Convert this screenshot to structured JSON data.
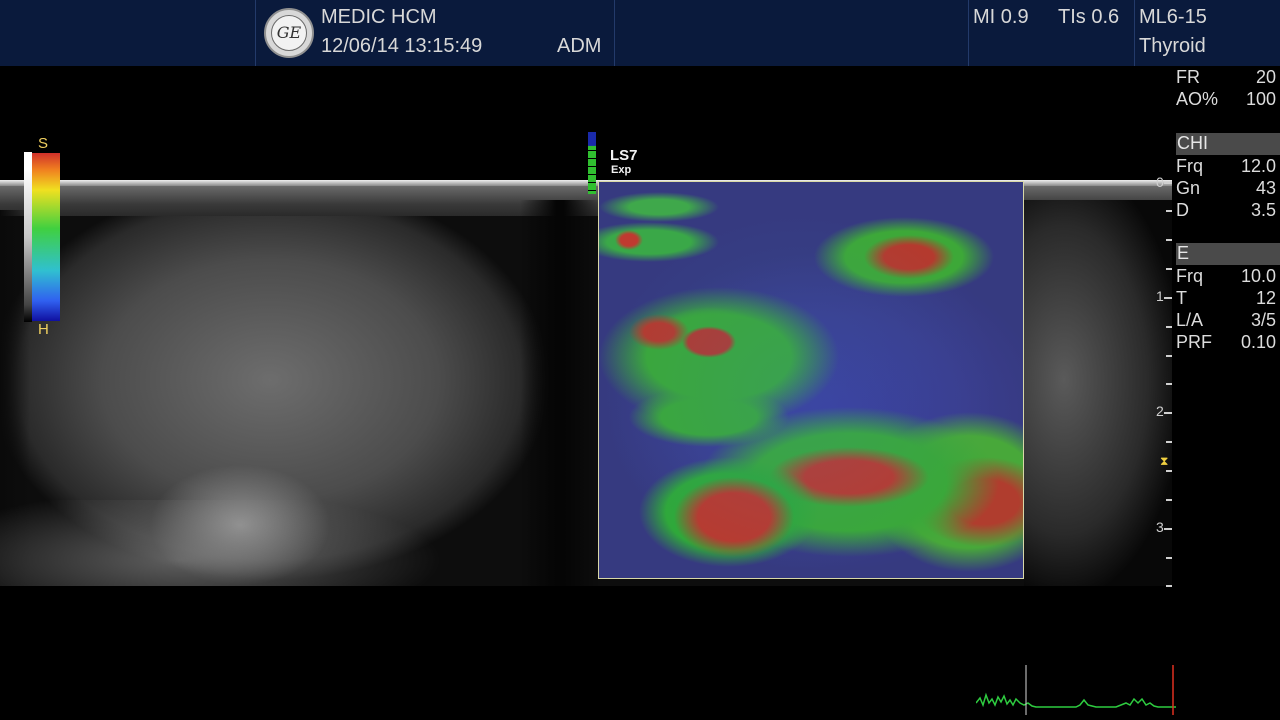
{
  "header": {
    "logo_text": "GE",
    "site": "MEDIC HCM",
    "datetime": "12/06/14 13:15:49",
    "operator": "ADM",
    "mi": "MI 0.9",
    "tis": "TIs 0.6",
    "probe": "ML6-15",
    "preset": "Thyroid"
  },
  "params": {
    "general": [
      {
        "key": "FR",
        "value": "20"
      },
      {
        "key": "AO%",
        "value": "100"
      }
    ],
    "chi_title": "CHI",
    "chi": [
      {
        "key": "Frq",
        "value": "12.0"
      },
      {
        "key": "Gn",
        "value": "43"
      },
      {
        "key": "D",
        "value": "3.5"
      }
    ],
    "e_title": "E",
    "e": [
      {
        "key": "Frq",
        "value": "10.0"
      },
      {
        "key": "T",
        "value": "12"
      },
      {
        "key": "L/A",
        "value": "3/5"
      },
      {
        "key": "PRF",
        "value": "0.10"
      }
    ]
  },
  "colorbar": {
    "top_label": "S",
    "bottom_label": "H"
  },
  "elastography": {
    "quality_label": "LS7",
    "mode_label": "Exp"
  },
  "depth_scale": {
    "labels": [
      "0",
      "1",
      "2",
      "3"
    ]
  },
  "colors": {
    "header_bg": "#0a1a3c",
    "label_yellow": "#f0d060",
    "ecg_green": "#2ecc40",
    "ecg_marker": "#e03020"
  }
}
